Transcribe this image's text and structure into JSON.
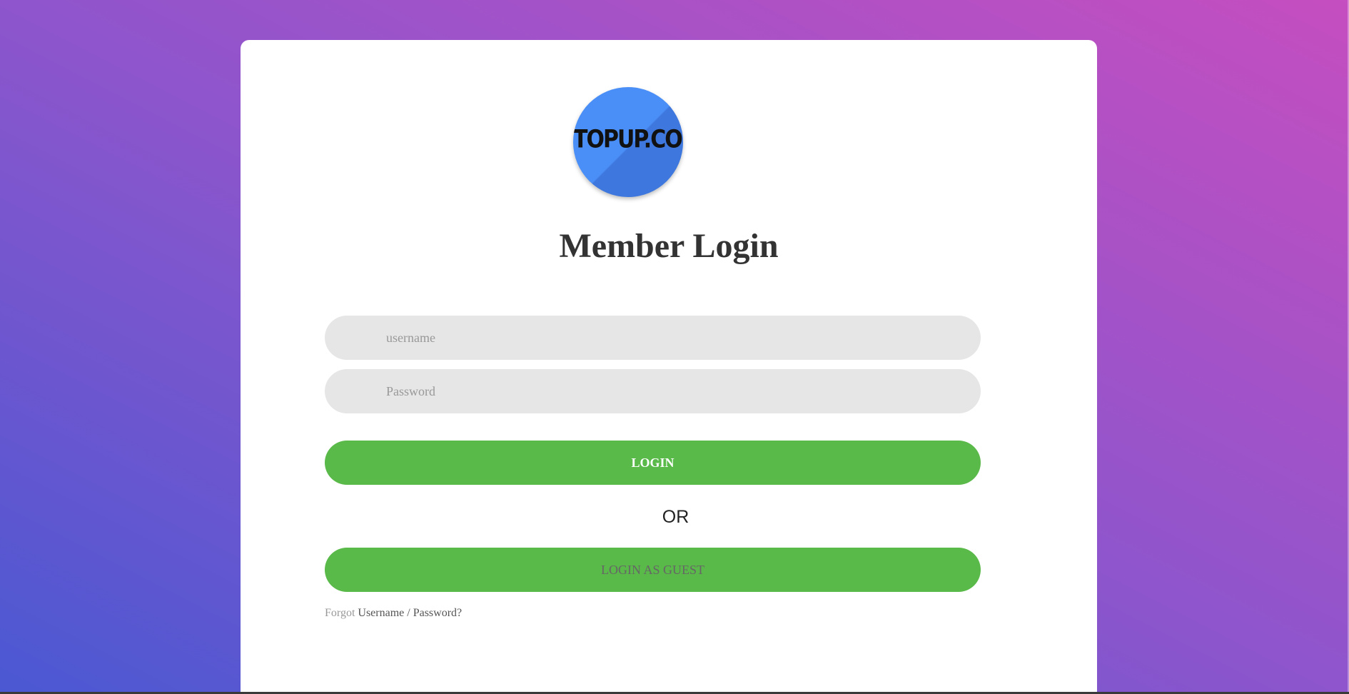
{
  "brand": {
    "logo_text": "TOPUP.COM",
    "logo_color": "#4a8ff7"
  },
  "login_form": {
    "title": "Member Login",
    "username_placeholder": "username",
    "password_placeholder": "Password",
    "login_label": "LOGIN",
    "or_label": "OR",
    "guest_label": "LOGIN AS GUEST",
    "forgot_prefix": "Forgot",
    "forgot_link": "Username / Password?"
  },
  "colors": {
    "button_green": "#59b949",
    "field_gray": "#e6e6e6",
    "gradient_start": "#4a58d2",
    "gradient_end": "#c54ec0"
  }
}
